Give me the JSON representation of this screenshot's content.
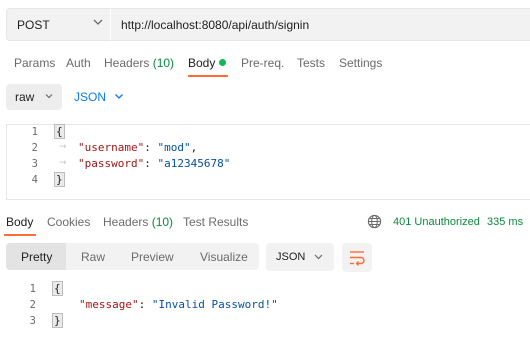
{
  "request": {
    "method": "POST",
    "url": "http://localhost:8080/api/auth/signin",
    "tabs": [
      {
        "label": "Params"
      },
      {
        "label": "Auth"
      },
      {
        "label": "Headers",
        "count": "(10)"
      },
      {
        "label": "Body"
      },
      {
        "label": "Pre-req."
      },
      {
        "label": "Tests"
      },
      {
        "label": "Settings"
      }
    ],
    "active_tab": "Body",
    "body_mode": "raw",
    "body_format": "JSON",
    "lines": [
      {
        "num": "1",
        "open": "{"
      },
      {
        "num": "2",
        "key": "\"username\"",
        "sep": ": ",
        "value": "\"mod\"",
        "end": ","
      },
      {
        "num": "3",
        "key": "\"password\"",
        "sep": ": ",
        "value": "\"a12345678\"",
        "end": ""
      },
      {
        "num": "4",
        "close": "}"
      }
    ]
  },
  "response": {
    "tabs": [
      {
        "label": "Body"
      },
      {
        "label": "Cookies"
      },
      {
        "label": "Headers",
        "count": "(10)"
      },
      {
        "label": "Test Results"
      }
    ],
    "active_tab": "Body",
    "status": "401 Unauthorized",
    "time": "335 ms",
    "views": [
      "Pretty",
      "Raw",
      "Preview",
      "Visualize"
    ],
    "active_view": "Pretty",
    "format": "JSON",
    "lines": [
      {
        "num": "1",
        "open": "{"
      },
      {
        "num": "2",
        "key": "\"message\"",
        "sep": ": ",
        "value": "\"Invalid Password!\"",
        "end": ""
      },
      {
        "num": "3",
        "close": "}"
      }
    ]
  },
  "colors": {
    "accent": "#ff6c37",
    "status": "#0b8a3e",
    "link": "#097bed",
    "dot": "#0cbb52"
  },
  "icons": [
    "chevron-down-icon",
    "globe-icon",
    "wrap-lines-icon"
  ]
}
